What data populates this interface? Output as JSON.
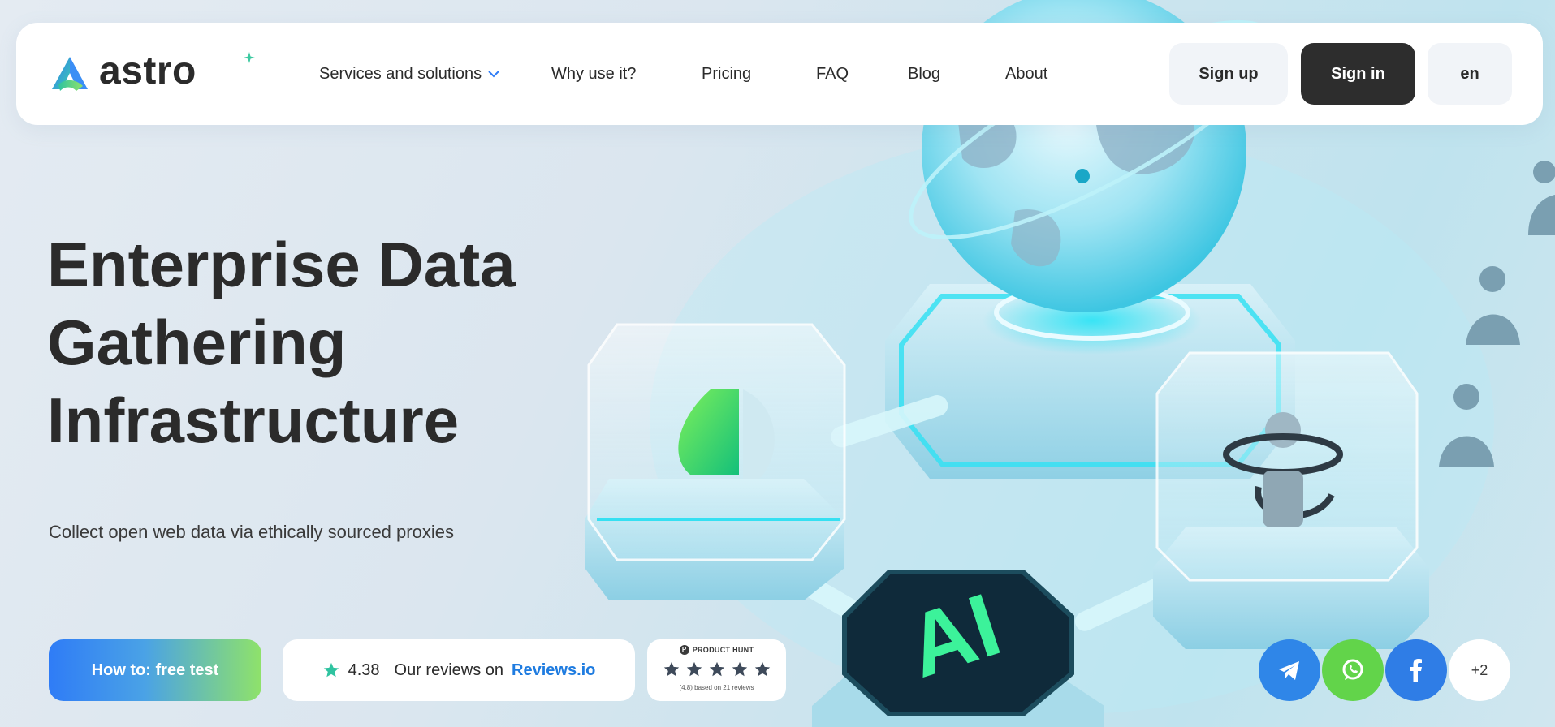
{
  "brand": {
    "name": "astro",
    "colors": {
      "accent_blue": "#2f7cf6",
      "accent_green": "#8fe26a",
      "dark": "#2d2d2d",
      "link": "#1f7ce0"
    }
  },
  "nav": {
    "items": [
      {
        "label": "Services and solutions",
        "has_dropdown": true,
        "icon": "chevron-down-icon"
      },
      {
        "label": "Why use it?"
      },
      {
        "label": "Pricing"
      },
      {
        "label": "FAQ"
      },
      {
        "label": "Blog"
      },
      {
        "label": "About"
      }
    ]
  },
  "auth": {
    "signup_label": "Sign up",
    "signin_label": "Sign in",
    "language": "en"
  },
  "hero": {
    "title_lines": [
      "Enterprise Data",
      "Gathering",
      "Infrastructure"
    ],
    "subtitle": "Collect open web data via ethically sourced proxies",
    "illustration_text": "AI"
  },
  "cta": {
    "label": "How to: free test"
  },
  "reviews": {
    "icon": "star-icon",
    "rating": "4.38",
    "text": "Our reviews on",
    "link_text": "Reviews.io"
  },
  "product_hunt": {
    "logo_letter": "P",
    "label": "PRODUCT HUNT",
    "stars": 5,
    "footer": "(4.8) based on 21 reviews"
  },
  "social": {
    "items": [
      {
        "name": "telegram",
        "icon": "telegram-icon"
      },
      {
        "name": "whatsapp",
        "icon": "whatsapp-icon"
      },
      {
        "name": "facebook",
        "icon": "facebook-icon"
      }
    ],
    "more_label": "+2"
  }
}
